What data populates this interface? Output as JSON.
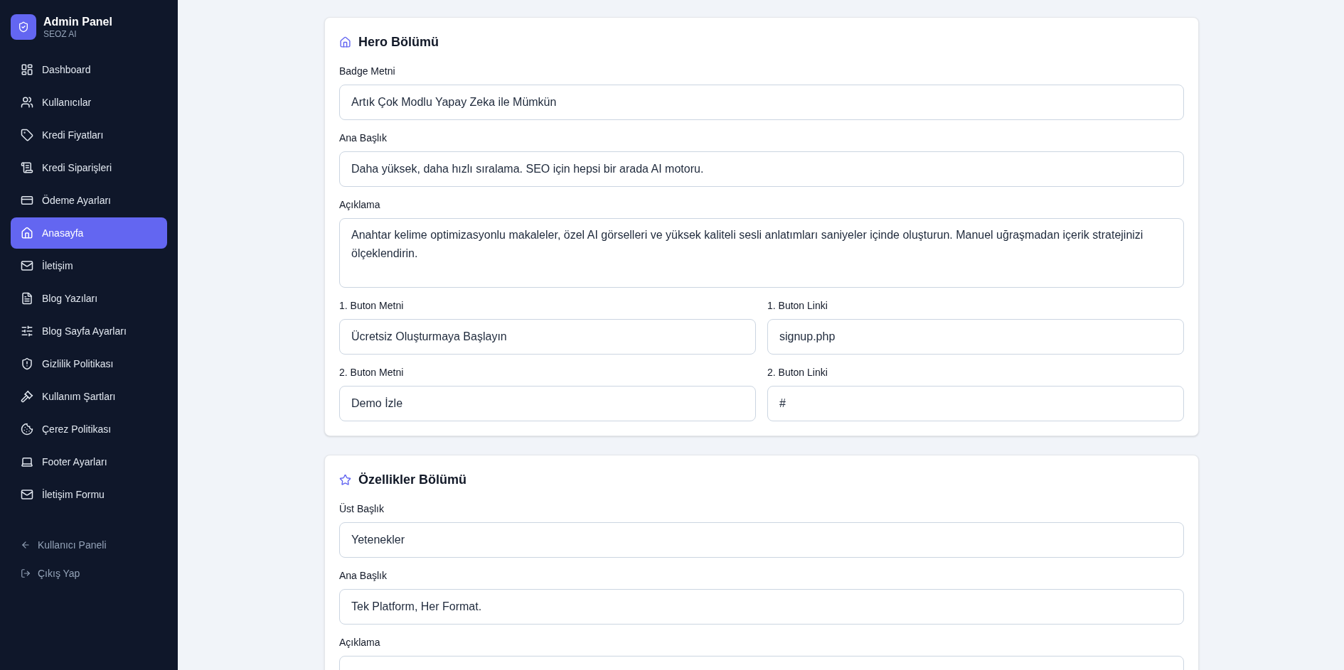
{
  "brand": {
    "title": "Admin Panel",
    "subtitle": "SEOZ AI"
  },
  "sidebar": {
    "items": [
      {
        "label": "Dashboard",
        "selected": false
      },
      {
        "label": "Kullanıcılar",
        "selected": false
      },
      {
        "label": "Kredi Fiyatları",
        "selected": false
      },
      {
        "label": "Kredi Siparişleri",
        "selected": false
      },
      {
        "label": "Ödeme Ayarları",
        "selected": false
      },
      {
        "label": "Anasayfa",
        "selected": true
      },
      {
        "label": "İletişim",
        "selected": false
      },
      {
        "label": "Blog Yazıları",
        "selected": false
      },
      {
        "label": "Blog Sayfa Ayarları",
        "selected": false
      },
      {
        "label": "Gizlilik Politikası",
        "selected": false
      },
      {
        "label": "Kullanım Şartları",
        "selected": false
      },
      {
        "label": "Çerez Politikası",
        "selected": false
      },
      {
        "label": "Footer Ayarları",
        "selected": false
      },
      {
        "label": "İletişim Formu",
        "selected": false
      }
    ],
    "footer_links": [
      {
        "label": "Kullanıcı Paneli"
      },
      {
        "label": "Çıkış Yap"
      }
    ]
  },
  "sections": [
    {
      "title": "Hero Bölümü",
      "rows": [
        [
          {
            "label": "Badge Metni",
            "kind": "input",
            "value": "Artık Çok Modlu Yapay Zeka ile Mümkün"
          }
        ],
        [
          {
            "label": "Ana Başlık",
            "kind": "input",
            "value": "Daha yüksek, daha hızlı sıralama. SEO için hepsi bir arada AI motoru."
          }
        ],
        [
          {
            "label": "Açıklama",
            "kind": "textarea",
            "value": "Anahtar kelime optimizasyonlu makaleler, özel AI görselleri ve yüksek kaliteli sesli anlatımları saniyeler içinde oluşturun. Manuel uğraşmadan içerik stratejinizi ölçeklendirin."
          }
        ],
        [
          {
            "label": "1. Buton Metni",
            "kind": "input",
            "value": "Ücretsiz Oluşturmaya Başlayın"
          },
          {
            "label": "1. Buton Linki",
            "kind": "input",
            "value": "signup.php"
          }
        ],
        [
          {
            "label": "2. Buton Metni",
            "kind": "input",
            "value": "Demo İzle"
          },
          {
            "label": "2. Buton Linki",
            "kind": "input",
            "value": "#"
          }
        ]
      ]
    },
    {
      "title": "Özellikler Bölümü",
      "rows": [
        [
          {
            "label": "Üst Başlık",
            "kind": "input",
            "value": "Yetenekler"
          }
        ],
        [
          {
            "label": "Ana Başlık",
            "kind": "input",
            "value": "Tek Platform, Her Format."
          }
        ],
        [
          {
            "label": "Açıklama",
            "kind": "textarea"
          }
        ]
      ]
    }
  ]
}
